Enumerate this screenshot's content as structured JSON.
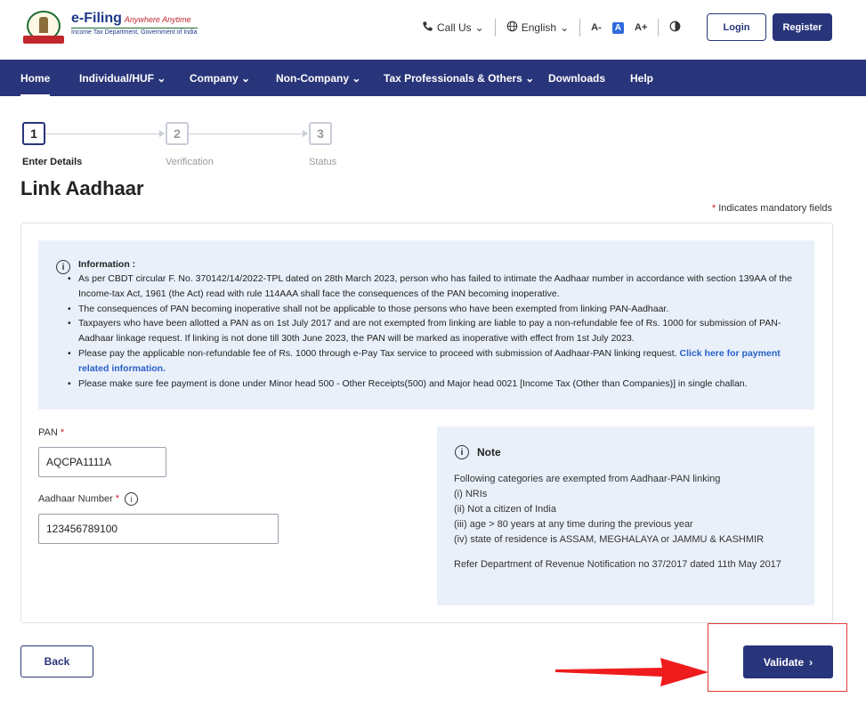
{
  "header": {
    "logo_title": "e-Filing",
    "logo_tagline": "Anywhere Anytime",
    "logo_subtitle": "Income Tax Department, Government of India",
    "call_us": "Call Us",
    "language": "English",
    "font_decrease": "A-",
    "font_default": "A",
    "font_increase": "A+",
    "login": "Login",
    "register": "Register"
  },
  "nav": {
    "items": [
      "Home",
      "Individual/HUF",
      "Company",
      "Non-Company",
      "Tax Professionals & Others",
      "Downloads",
      "Help"
    ],
    "active": "Home"
  },
  "stepper": {
    "steps": [
      {
        "number": "1",
        "label": "Enter Details"
      },
      {
        "number": "2",
        "label": "Verification"
      },
      {
        "number": "3",
        "label": "Status"
      }
    ],
    "current": 1
  },
  "page": {
    "title": "Link Aadhaar",
    "mandatory_note": "Indicates mandatory fields"
  },
  "information": {
    "title": "Information :",
    "items": [
      "As per CBDT circular F. No. 370142/14/2022-TPL dated on 28th March 2023, person who has failed to intimate the Aadhaar number in accordance with section 139AA of the Income-tax Act, 1961 (the Act) read with rule 114AAA shall face the consequences of the PAN becoming inoperative.",
      "The consequences of PAN becoming inoperative shall not be applicable to those persons who have been exempted from linking PAN-Aadhaar.",
      "Taxpayers who have been allotted a PAN as on 1st July 2017 and are not exempted from linking are liable to pay a non-refundable fee of Rs. 1000 for submission of PAN-Aadhaar linkage request. If linking is not done till 30th June 2023, the PAN will be marked as inoperative with effect from 1st July 2023.",
      "Please pay the applicable non-refundable fee of Rs. 1000 through e-Pay Tax service to proceed with submission of Aadhaar-PAN linking request.",
      "Please make sure fee payment is done under Minor head 500 - Other Receipts(500) and Major head 0021 [Income Tax (Other than Companies)] in single challan."
    ],
    "payment_link": "Click here for payment related information."
  },
  "form": {
    "pan_label": "PAN",
    "pan_value": "AQCPA1111A",
    "aadhaar_label": "Aadhaar Number",
    "aadhaar_value": "123456789100"
  },
  "note": {
    "title": "Note",
    "heading": "Following categories are exempted from Aadhaar-PAN linking",
    "items": [
      "(i) NRIs",
      "(ii) Not a citizen of India",
      "(iii) age > 80 years at any time during the previous year",
      "(iv) state of residence is ASSAM, MEGHALAYA or JAMMU & KASHMIR"
    ],
    "reference": "Refer Department of Revenue Notification no 37/2017 dated 11th May 2017"
  },
  "actions": {
    "back": "Back",
    "validate": "Validate"
  },
  "colors": {
    "brand_navy": "#29357a",
    "highlight_red": "#e53a3a",
    "info_bg": "#eaf0fa"
  }
}
